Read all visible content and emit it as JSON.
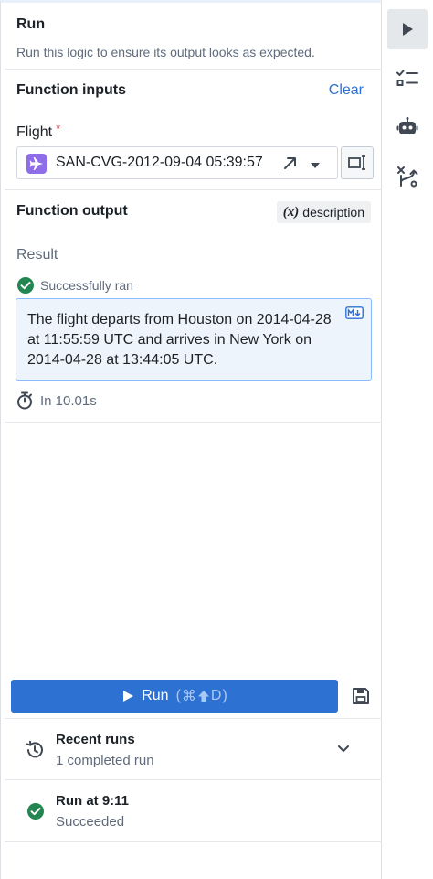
{
  "run": {
    "title": "Run",
    "subtitle": "Run this logic to ensure its output looks as expected."
  },
  "inputs": {
    "title": "Function inputs",
    "clear_label": "Clear",
    "flight_label": "Flight",
    "required_marker": "*",
    "flight_value": "SAN-CVG-2012-09-04 05:39:57"
  },
  "output": {
    "title": "Function output",
    "variable_symbol": "(x)",
    "variable_name": "description",
    "result_label": "Result",
    "status": "Successfully ran",
    "text": "The flight departs from Houston on 2014-04-28 at 11:55:59 UTC and arrives in New York on 2014-04-28 at 13:44:05 UTC.",
    "format_badge": "M↓",
    "duration": "In 10.01s"
  },
  "run_button": {
    "label": "Run",
    "shortcut_cmd": "⌘",
    "shortcut_key": "D",
    "shortcut_open": "(",
    "shortcut_close": ")"
  },
  "recent_runs": {
    "title": "Recent runs",
    "subtitle": "1 completed run",
    "items": [
      {
        "title": "Run at 9:11",
        "status": "Succeeded"
      }
    ]
  },
  "colors": {
    "accent": "#2d72d2",
    "success": "#238551",
    "flight_icon_bg": "#8f6de8"
  }
}
